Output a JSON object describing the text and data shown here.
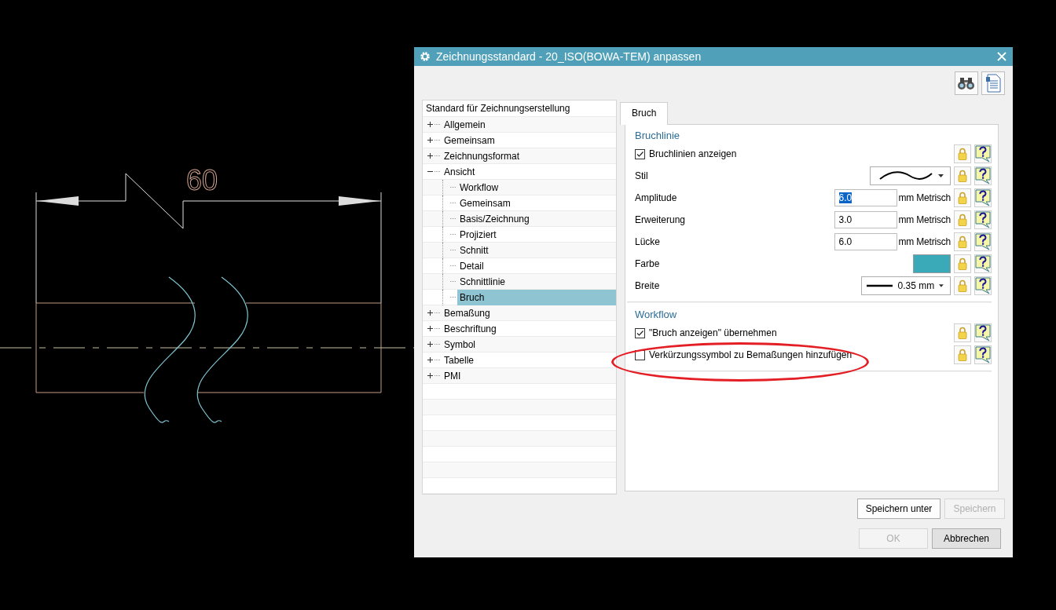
{
  "drawing": {
    "dimension": "60"
  },
  "dialog": {
    "title": "Zeichnungsstandard - 20_ISO(BOWA-TEM) anpassen",
    "tree": {
      "header": "Standard für Zeichnungserstellung",
      "items": [
        {
          "label": "Allgemein",
          "expanded": false,
          "selected": false
        },
        {
          "label": "Gemeinsam",
          "expanded": false,
          "selected": false
        },
        {
          "label": "Zeichnungsformat",
          "expanded": false,
          "selected": false
        },
        {
          "label": "Ansicht",
          "expanded": true,
          "selected": false,
          "children": [
            {
              "label": "Workflow",
              "selected": false
            },
            {
              "label": "Gemeinsam",
              "selected": false
            },
            {
              "label": "Basis/Zeichnung",
              "selected": false
            },
            {
              "label": "Projiziert",
              "selected": false
            },
            {
              "label": "Schnitt",
              "selected": false
            },
            {
              "label": "Detail",
              "selected": false
            },
            {
              "label": "Schnittlinie",
              "selected": false
            },
            {
              "label": "Bruch",
              "selected": true
            }
          ]
        },
        {
          "label": "Bemaßung",
          "expanded": false,
          "selected": false
        },
        {
          "label": "Beschriftung",
          "expanded": false,
          "selected": false
        },
        {
          "label": "Symbol",
          "expanded": false,
          "selected": false
        },
        {
          "label": "Tabelle",
          "expanded": false,
          "selected": false
        },
        {
          "label": "PMI",
          "expanded": false,
          "selected": false
        }
      ]
    },
    "tabs": [
      {
        "label": "Bruch",
        "selected": true
      }
    ],
    "sections": [
      {
        "title": "Bruchlinie",
        "rows": [
          {
            "kind": "checkbox",
            "label": "Bruchlinien anzeigen",
            "checked": true
          },
          {
            "kind": "line_style",
            "label": "Stil"
          },
          {
            "kind": "number",
            "label": "Amplitude",
            "value": "6.0",
            "unit": "mm Metrisch",
            "text_selected": true
          },
          {
            "kind": "number",
            "label": "Erweiterung",
            "value": "3.0",
            "unit": "mm Metrisch",
            "text_selected": false
          },
          {
            "kind": "number",
            "label": "Lücke",
            "value": "6.0",
            "unit": "mm Metrisch",
            "text_selected": false
          },
          {
            "kind": "color",
            "label": "Farbe",
            "color": "#3aaab8"
          },
          {
            "kind": "line_width",
            "label": "Breite",
            "value": "0.35 mm"
          }
        ]
      },
      {
        "title": "Workflow",
        "rows": [
          {
            "kind": "checkbox",
            "label": "\"Bruch anzeigen\" übernehmen",
            "checked": true
          },
          {
            "kind": "checkbox",
            "label": "Verkürzungssymbol zu Bemaßungen hinzufügen",
            "checked": false
          }
        ]
      }
    ],
    "buttons": [
      {
        "label": "Speichern unter",
        "disabled": false
      },
      {
        "label": "Speichern",
        "disabled": true
      }
    ],
    "footer_buttons": [
      {
        "label": "OK",
        "disabled": true
      },
      {
        "label": "Abbrechen",
        "disabled": false
      }
    ]
  }
}
